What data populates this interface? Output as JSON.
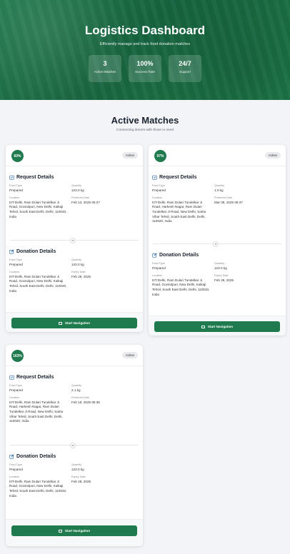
{
  "hero": {
    "title": "Logistics Dashboard",
    "subtitle": "Efficiently manage and track food donation matches",
    "stats": [
      {
        "value": "3",
        "label": "Active Matches"
      },
      {
        "value": "100%",
        "label": "Success Rate"
      },
      {
        "value": "24/7",
        "label": "Support"
      }
    ]
  },
  "section": {
    "title": "Active Matches",
    "subtitle": "Connecting donors with those in need"
  },
  "labels": {
    "request": "Request Details",
    "donation": "Donation Details",
    "food_type": "Food Type",
    "quantity": "Quantity",
    "location": "Location",
    "preferred_date": "Preferred Date",
    "expiry_date": "Expiry Date",
    "nav_button": "Start Navigation"
  },
  "cards": [
    {
      "score": "60%",
      "status": "Active",
      "request": {
        "food_type": "Prepared",
        "quantity": "123.0 kg",
        "location": "IIIT-Delhi, Ram Dulari Tundelkar Ji Road, Govindpuri, New Delhi, Kalkaji Tehsil, South East Delhi, Delhi, 110020, India",
        "date": "Feb 13, 2025 06:27"
      },
      "donation": {
        "food_type": "Prepared",
        "quantity": "123.0 kg",
        "location": "IIIT-Delhi, Ram Dulari Tundelkar Ji Road, Govindpuri, New Delhi, Kalkaji Tehsil, South East Delhi, Delhi, 110020, India",
        "date": "Feb 28, 2025"
      }
    },
    {
      "score": "97%",
      "status": "Active",
      "request": {
        "food_type": "Prepared",
        "quantity": "1.0 kg",
        "location": "IIIT-Delhi, Ram Dulari Tundelkar Ji Road, Harkesh Nagar, Ram Dulari Tundelkar Ji Road, New Delhi, Sarita Vihar Tehsil, South East Delhi, Delhi, 110020, India",
        "date": "Mar 08, 2025 06:37"
      },
      "donation": {
        "food_type": "Prepared",
        "quantity": "123.0 kg",
        "location": "IIIT-Delhi, Ram Dulari Tundelkar Ji Road, Govindpuri, New Delhi, Kalkaji Tehsil, South East Delhi, Delhi, 110020, India",
        "date": "Feb 28, 2025"
      }
    },
    {
      "score": "163%",
      "status": "Active",
      "request": {
        "food_type": "Prepared",
        "quantity": "2.1 kg",
        "location": "IIIT-Delhi, Ram Dulari Tundelkar Ji Road, Harkesh Nagar, Ram Dulari Tundelkar Ji Road, New Delhi, Sarita Vihar Tehsil, South East Delhi, Delhi, 110020, India",
        "date": "Feb 19, 2025 06:38"
      },
      "donation": {
        "food_type": "Prepared",
        "quantity": "123.0 kg",
        "location": "IIIT-Delhi, Ram Dulari Tundelkar Ji Road, Govindpuri, New Delhi, Kalkaji Tehsil, South East Delhi, Delhi, 110020, India",
        "date": "Feb 28, 2025"
      }
    }
  ]
}
